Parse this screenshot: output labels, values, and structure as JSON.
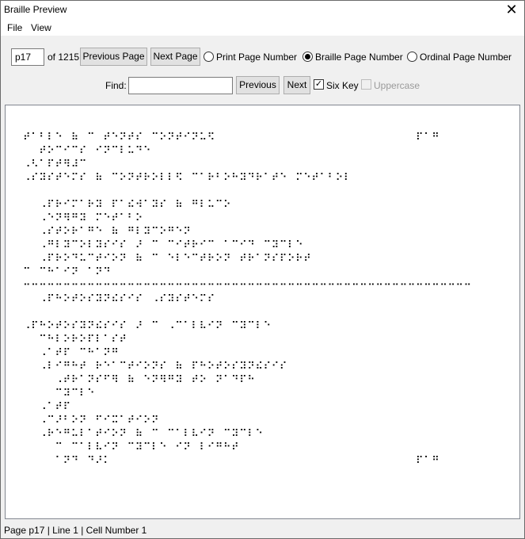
{
  "window": {
    "title": "Braille Preview",
    "close_glyph": "✕"
  },
  "menu": {
    "items": [
      "File",
      "View"
    ]
  },
  "nav": {
    "page_value": "p17",
    "of_label": "of 1215",
    "prev_label": "Previous Page",
    "next_label": "Next Page",
    "radios": [
      {
        "label": "Print Page Number",
        "selected": false
      },
      {
        "label": "Braille Page Number",
        "selected": true
      },
      {
        "label": "Ordinal Page Number",
        "selected": false
      }
    ]
  },
  "find": {
    "label": "Find:",
    "value": "",
    "previous_label": "Previous",
    "next_label": "Next",
    "six_key_label": "Six Key",
    "six_key_checked": true,
    "uppercase_label": "Uppercase",
    "uppercase_checked": false
  },
  "braille_lines": [
    "⠞⠁⠃⠇⠑⠀⠷⠀⠉⠀⠞⠑⠝⠞⠎⠀⠉⠕⠝⠞⠊⠝⠥⠫⠀⠀⠀⠀⠀⠀⠀⠀⠀⠀⠀⠀⠀⠀⠀⠀⠀⠀⠀⠀⠀⠀⠀⠀⠀⠏⠁⠛",
    "⠀⠀⠞⠕⠉⠊⠉⠎⠀⠊⠝⠉⠇⠥⠙⠑",
    "⠠⠣⠁⠏⠞⠻⠼⠉",
    "⠠⠎⠽⠎⠞⠑⠍⠎⠀⠷⠀⠉⠕⠝⠞⠗⠕⠇⠇⠫⠀⠉⠁⠗⠃⠕⠓⠽⠙⠗⠁⠞⠑⠀⠍⠑⠞⠁⠃⠕⠇",
    "",
    "⠀⠀⠠⠏⠗⠊⠍⠁⠗⠽⠀⠏⠁⠮⠺⠁⠽⠎⠀⠷⠀⠛⠇⠥⠉⠕",
    "⠀⠀⠠⠑⠝⠻⠛⠽⠀⠍⠑⠞⠁⠃⠕",
    "⠀⠀⠠⠎⠞⠕⠗⠁⠛⠑⠀⠷⠀⠛⠇⠽⠉⠕⠛⠑⠝",
    "⠀⠀⠠⠛⠇⠽⠉⠕⠇⠽⠎⠊⠎⠀⠜⠀⠉⠀⠉⠊⠞⠗⠊⠉⠀⠁⠉⠊⠙⠀⠉⠽⠉⠇⠑",
    "⠀⠀⠠⠏⠗⠕⠙⠥⠉⠞⠊⠕⠝⠀⠷⠀⠉⠀⠑⠇⠑⠉⠞⠗⠕⠝⠀⠞⠗⠁⠝⠎⠏⠕⠗⠞",
    "⠉⠀⠉⠓⠁⠊⠝⠀⠁⠝⠙⠀⠀⠀⠀⠀⠀⠀⠀⠀⠀⠀⠀⠀⠀⠀⠀⠀⠀⠀⠀⠀⠀⠀⠀⠀⠀⠀",
    "⠒⠒⠒⠒⠒⠒⠒⠒⠒⠒⠒⠒⠒⠒⠒⠒⠒⠒⠒⠒⠒⠒⠒⠒⠒⠒⠒⠒⠒⠒⠒⠒⠒⠒⠒⠒⠒⠒⠒⠒⠒⠒⠒⠒⠒⠒⠒⠒⠒⠒⠒⠒⠒⠒⠒⠒",
    "⠀⠀⠠⠏⠓⠕⠞⠕⠎⠽⠝⠮⠎⠊⠎⠀⠠⠎⠽⠎⠞⠑⠍⠎",
    "",
    "⠠⠏⠓⠕⠞⠕⠎⠽⠝⠮⠎⠊⠎⠀⠜⠀⠉⠀⠠⠉⠁⠇⠧⠊⠝⠀⠉⠽⠉⠇⠑",
    "⠀⠀⠉⠓⠇⠕⠗⠕⠏⠇⠁⠎⠞",
    "⠀⠀⠠⠁⠞⠏⠀⠉⠓⠁⠝⠛",
    "⠀⠀⠠⠇⠊⠛⠓⠞⠀⠗⠑⠁⠉⠞⠊⠕⠝⠎⠀⠷⠀⠏⠓⠕⠞⠕⠎⠽⠝⠮⠎⠊⠎",
    "⠀⠀⠀⠀⠠⠞⠗⠁⠝⠎⠋⠻⠀⠷⠀⠑⠝⠻⠛⠽⠀⠞⠕⠀⠝⠁⠙⠏⠓",
    "⠀⠀⠀⠀⠉⠽⠉⠇⠑",
    "⠀⠀⠠⠁⠞⠏",
    "⠀⠀⠠⠉⠜⠃⠕⠝⠀⠋⠊⠭⠁⠞⠊⠕⠝",
    "⠀⠀⠠⠗⠑⠛⠥⠇⠁⠞⠊⠕⠝⠀⠷⠀⠉⠀⠉⠁⠇⠧⠊⠝⠀⠉⠽⠉⠇⠑",
    "⠀⠀⠀⠀⠉⠀⠉⠁⠇⠧⠊⠝⠀⠉⠽⠉⠇⠑⠀⠊⠝⠀⠇⠊⠛⠓⠞",
    "⠀⠀⠀⠀⠁⠝⠙⠀⠙⠜⠅⠀⠀⠀⠀⠀⠀⠀⠀⠀⠀⠀⠀⠀⠀⠀⠀⠀⠀⠀⠀⠀⠀⠀⠀⠀⠀⠀⠀⠀⠀⠀⠀⠀⠀⠀⠀⠀⠀⠏⠁⠛"
  ],
  "status": "Page p17 | Line 1 | Cell Number 1"
}
